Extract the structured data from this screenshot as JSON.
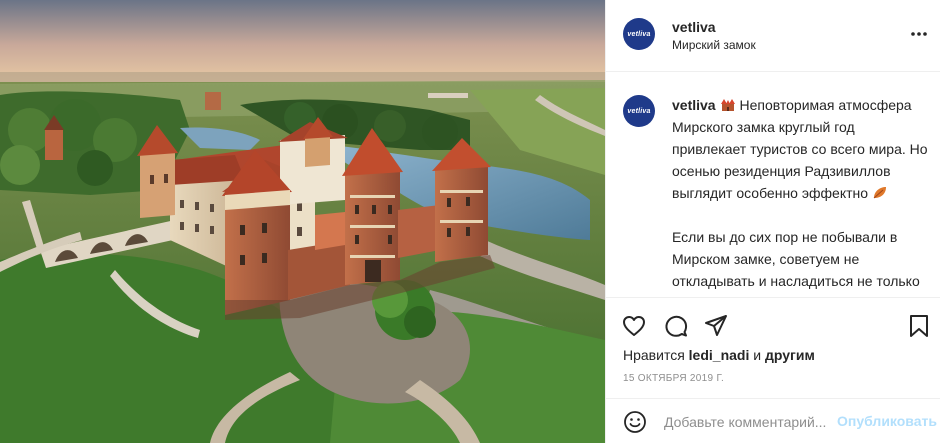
{
  "post": {
    "username": "vetliva",
    "location": "Мирский замок",
    "avatar_text": "vetliva",
    "caption_paragraph_1": "Неповторимая атмосфера Мирского замка круглый год привлекает туристов со всего мира. Но осенью резиденция Радзивиллов выглядит особенно эффектно",
    "caption_paragraph_2": "Если вы до сих пор не побывали в Мирском замке, советуем не откладывать и насладиться не только отличной экскурсией, но и ...",
    "likes_prefix": "Нравится",
    "likes_user": "ledi_nadi",
    "likes_and": "и",
    "likes_others": "другим",
    "date": "15 ОКТЯБРЯ 2019 Г."
  },
  "comment": {
    "placeholder": "Добавьте комментарий...",
    "publish_label": "Опубликовать"
  },
  "icons": {
    "more": "more-options-icon",
    "like": "heart-icon",
    "comment": "comment-icon",
    "share": "share-icon",
    "save": "bookmark-icon",
    "emoji": "smile-icon",
    "castle_emoji": "castle-emoji-icon",
    "leaf_emoji": "leaf-emoji-icon"
  },
  "colors": {
    "avatar_bg": "#1f3a8a",
    "publish_disabled": "#b2dffc",
    "secondary_text": "#8e8e8e"
  }
}
